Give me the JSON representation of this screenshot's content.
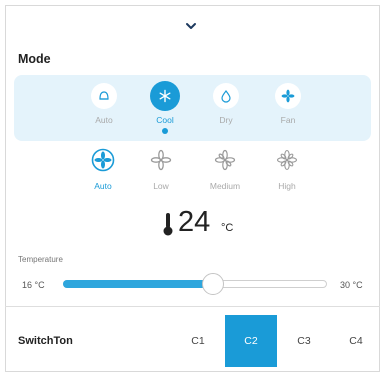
{
  "header": {
    "collapse_icon": "chevron-down-icon"
  },
  "mode": {
    "title": "Mode",
    "items": [
      {
        "label": "Auto",
        "icon": "auto-mode-icon",
        "active": false
      },
      {
        "label": "Cool",
        "icon": "snowflake-icon",
        "active": true
      },
      {
        "label": "Dry",
        "icon": "droplet-icon",
        "active": false
      },
      {
        "label": "Fan",
        "icon": "fan-icon",
        "active": false
      }
    ]
  },
  "fan_speed": {
    "items": [
      {
        "label": "Auto",
        "icon": "fan-auto-icon",
        "active": true
      },
      {
        "label": "Low",
        "icon": "fan-low-icon",
        "active": false
      },
      {
        "label": "Medium",
        "icon": "fan-medium-icon",
        "active": false
      },
      {
        "label": "High",
        "icon": "fan-high-icon",
        "active": false
      }
    ]
  },
  "temperature": {
    "value": "24",
    "unit": "°C",
    "caption": "Temperature",
    "min_label": "16 °C",
    "max_label": "30 °C",
    "level_fraction": 0.57
  },
  "switch": {
    "label": "SwitchTon",
    "channels": [
      {
        "label": "C1",
        "active": false
      },
      {
        "label": "C2",
        "active": true
      },
      {
        "label": "C3",
        "active": false
      },
      {
        "label": "C4",
        "active": false
      }
    ]
  },
  "colors": {
    "accent": "#1a9bd7",
    "strip_background": "#e4f3fb",
    "inactive_text": "#a9a9a9"
  }
}
